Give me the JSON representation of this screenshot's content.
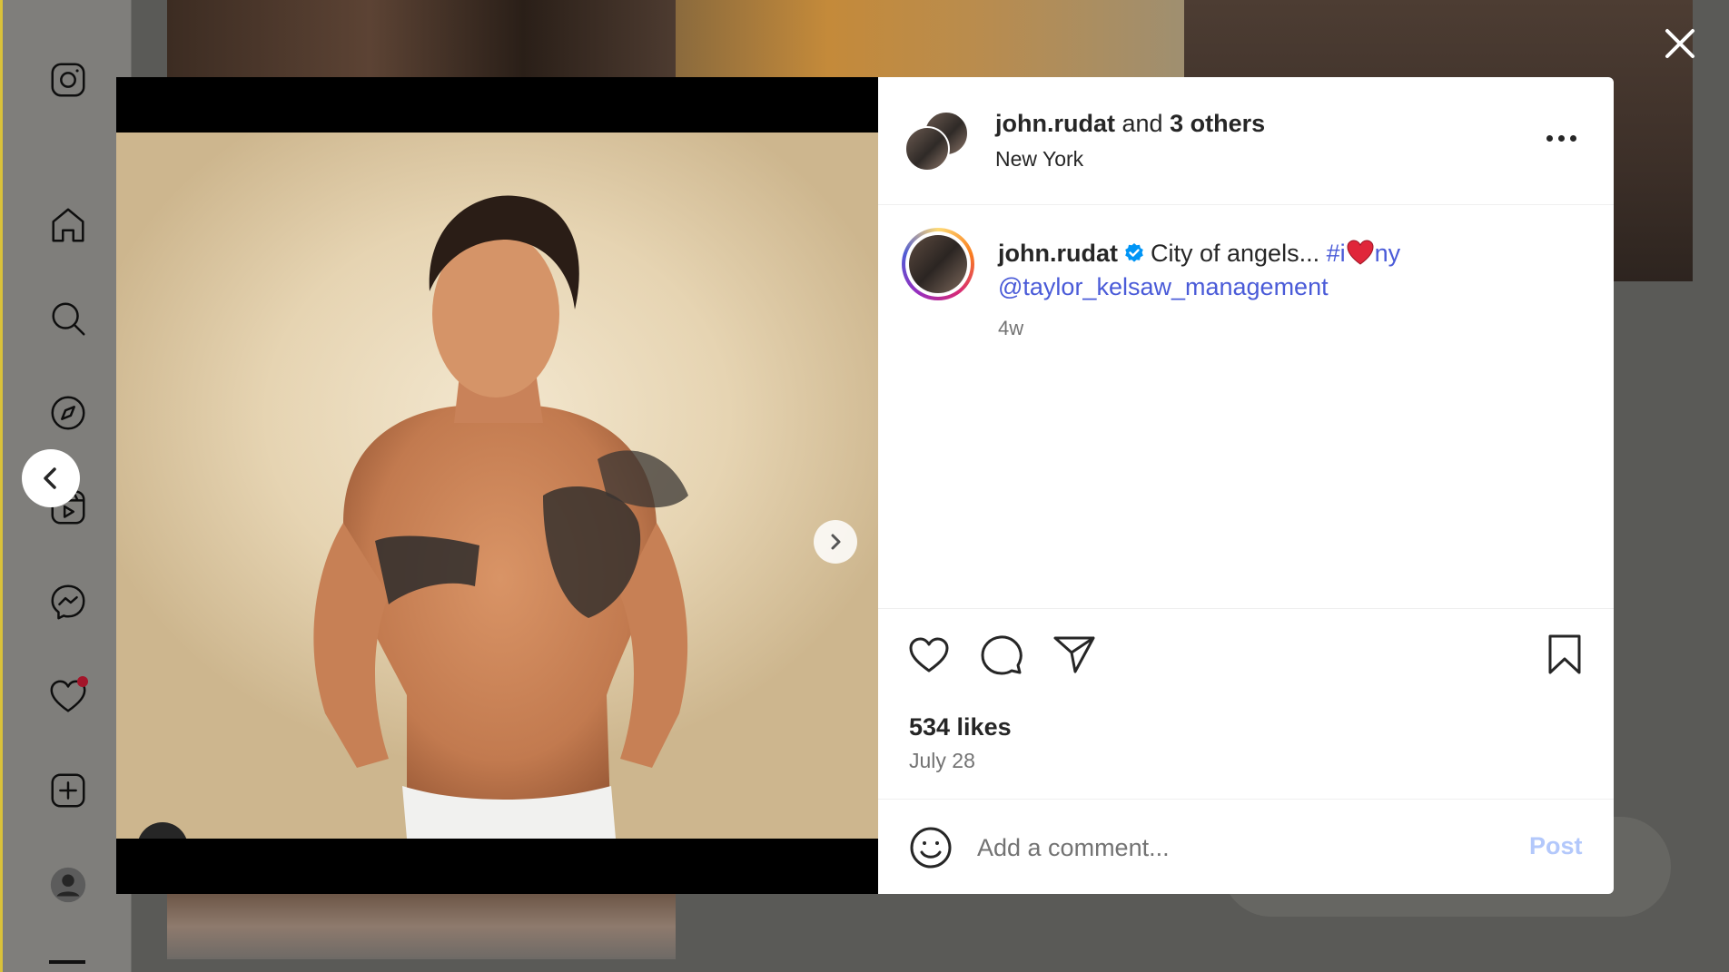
{
  "nav": {
    "items": [
      "instagram-logo",
      "home",
      "search",
      "explore",
      "reels",
      "messenger",
      "notifications",
      "create",
      "profile",
      "more"
    ]
  },
  "post": {
    "header": {
      "username": "john.rudat",
      "connector": "and",
      "others": "3 others",
      "location": "New York"
    },
    "caption": {
      "username": "john.rudat",
      "text": "City of angels...",
      "hashtag_prefix": "#i",
      "hashtag_suffix": "ny",
      "mention": "@taylor_kelsaw_management",
      "age": "4w"
    },
    "likes": "534 likes",
    "date": "July 28",
    "carousel": {
      "count": 3,
      "active": 0
    }
  },
  "comment": {
    "placeholder": "Add a comment...",
    "post_label": "Post"
  },
  "colors": {
    "link": "#4a5bd8",
    "verified": "#0095f6",
    "post_disabled": "#b3c8fb",
    "notification_dot": "#a3152a"
  }
}
